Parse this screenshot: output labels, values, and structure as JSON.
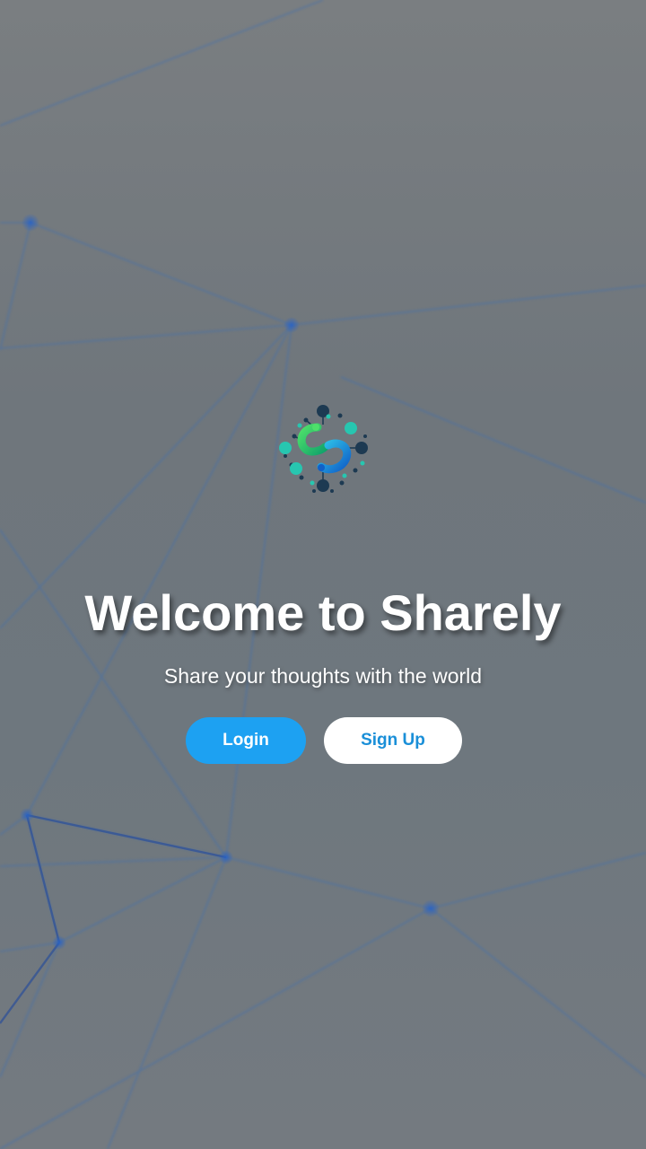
{
  "welcome": {
    "title": "Welcome to Sharely",
    "subtitle": "Share your thoughts with the world",
    "login_label": "Login",
    "signup_label": "Sign Up"
  },
  "colors": {
    "primary": "#1da1f2",
    "signup_text": "#1a8fd8",
    "overlay": "#70777d",
    "text": "#ffffff"
  },
  "icons": {
    "logo": "sharely-logo-icon",
    "background": "network-graph-background"
  }
}
